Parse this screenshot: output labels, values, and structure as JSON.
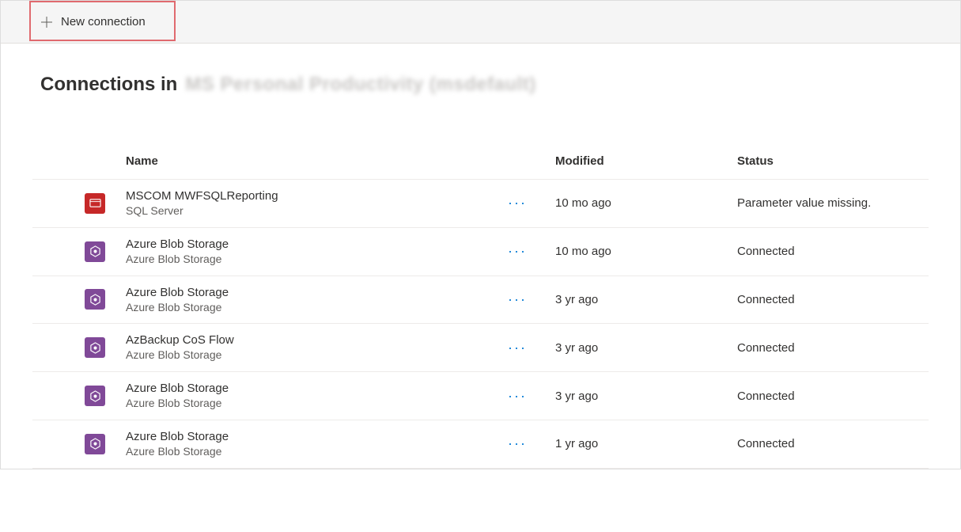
{
  "toolbar": {
    "new_connection_label": "New connection"
  },
  "page": {
    "title_prefix": "Connections in",
    "environment_name_blurred": "MS Personal Productivity (msdefault)"
  },
  "table": {
    "headers": {
      "name": "Name",
      "modified": "Modified",
      "status": "Status"
    },
    "rows": [
      {
        "icon": "sql-server-icon",
        "name": "MSCOM MWFSQLReporting",
        "subtitle": "SQL Server",
        "modified": "10 mo ago",
        "status": "Parameter value missing."
      },
      {
        "icon": "azure-blob-icon",
        "name": "Azure Blob Storage",
        "subtitle": "Azure Blob Storage",
        "modified": "10 mo ago",
        "status": "Connected"
      },
      {
        "icon": "azure-blob-icon",
        "name": "Azure Blob Storage",
        "subtitle": "Azure Blob Storage",
        "modified": "3 yr ago",
        "status": "Connected"
      },
      {
        "icon": "azure-blob-icon",
        "name": "AzBackup CoS Flow",
        "subtitle": "Azure Blob Storage",
        "modified": "3 yr ago",
        "status": "Connected"
      },
      {
        "icon": "azure-blob-icon",
        "name": "Azure Blob Storage",
        "subtitle": "Azure Blob Storage",
        "modified": "3 yr ago",
        "status": "Connected"
      },
      {
        "icon": "azure-blob-icon",
        "name": "Azure Blob Storage",
        "subtitle": "Azure Blob Storage",
        "modified": "1 yr ago",
        "status": "Connected"
      }
    ]
  }
}
